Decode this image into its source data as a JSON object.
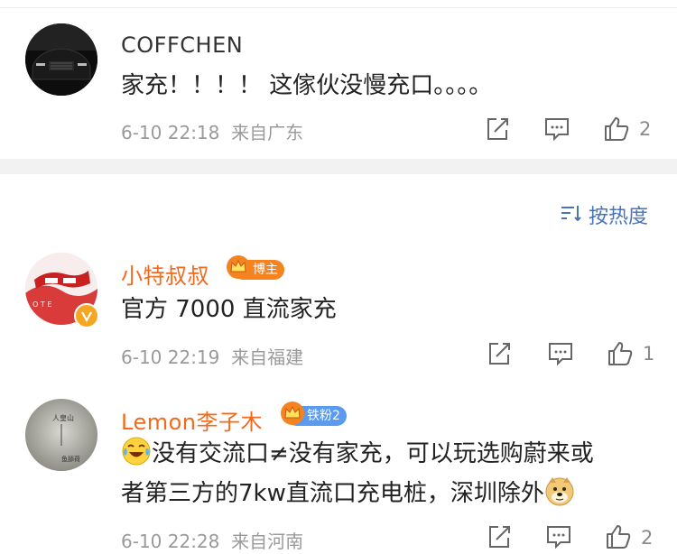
{
  "comments": [
    {
      "username": "COFFCHEN",
      "text": "家充！！！！ 这傢伙没慢充口。。。。",
      "time": "6-10 22:18",
      "location": "来自广东",
      "likes": "2"
    },
    {
      "username": "小特叔叔",
      "badge": "博主",
      "text": "官方 7000 直流家充",
      "time": "6-10 22:19",
      "location": "来自福建",
      "likes": "1"
    },
    {
      "username": "Lemon李子木",
      "badge": "铁粉2",
      "text_line1": "没有交流口≠没有家充，可以玩选购蔚来或",
      "text_line2": "者第三方的7kw直流口充电桩，深圳除外",
      "time": "6-10 22:28",
      "location": "来自河南",
      "likes": "2"
    }
  ],
  "sort": {
    "label": "按热度"
  },
  "avatar_texts": {
    "lemon_line1": "人皇山",
    "lemon_line2": "鱼舔荷"
  },
  "colors": {
    "orange_name": "#f26a1b",
    "blue_link": "#4a74b8",
    "separator": "#f2f2f2"
  },
  "icons": [
    "share-icon",
    "comment-icon",
    "like-icon",
    "crown-icon",
    "sort-icon",
    "laughing-tears-emoji",
    "doge-emoji",
    "verified-icon"
  ]
}
